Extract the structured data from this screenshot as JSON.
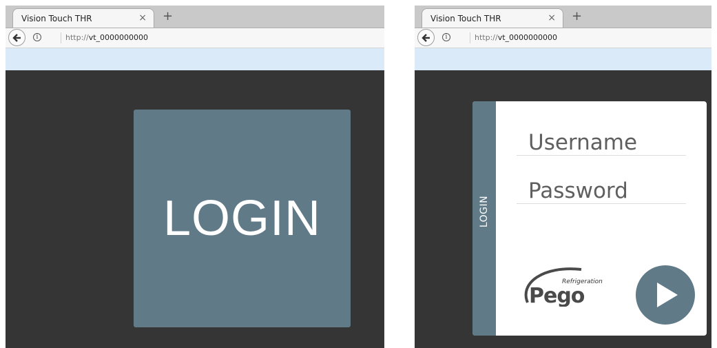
{
  "left_screen": {
    "tab_title": "Vision Touch THR",
    "tab_close": "×",
    "new_tab": "+",
    "url_scheme": "http://",
    "url_host": "vt_0000000000",
    "login_tile_label": "LOGIN"
  },
  "right_screen": {
    "tab_title": "Vision Touch THR",
    "tab_close": "×",
    "new_tab": "+",
    "url_scheme": "http://",
    "url_host": "vt_0000000000",
    "side_label": "LOGIN",
    "username_placeholder": "Username",
    "password_placeholder": "Password",
    "logo_text": "Pego",
    "logo_subtext": "Refrigeration",
    "submit_icon": "play-icon"
  },
  "colors": {
    "panel_accent": "#607a88",
    "stage_background": "#353535",
    "toolbar_band": "#dbeaf8"
  }
}
